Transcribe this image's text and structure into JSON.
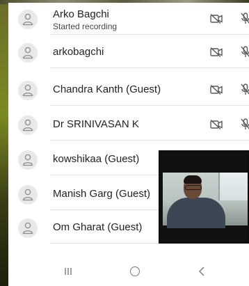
{
  "participants": [
    {
      "name": "Arko  Bagchi",
      "status": "Started recording",
      "cam_icon": "camera-off-icon",
      "mic_icon": "mic-off-icon"
    },
    {
      "name": "arkobagchi",
      "cam_icon": "camera-off-icon",
      "mic_icon": "mic-off-icon"
    },
    {
      "name": "Chandra Kanth (Guest)",
      "cam_icon": "camera-off-icon",
      "mic_icon": "mic-off-icon"
    },
    {
      "name": "Dr SRINIVASAN K",
      "cam_icon": "camera-off-icon",
      "mic_icon": "mic-off-icon"
    },
    {
      "name": "kowshikaa (Guest)"
    },
    {
      "name": "Manish Garg (Guest)"
    },
    {
      "name": "Om Gharat (Guest)"
    }
  ],
  "navbar": {
    "recents_icon": "recents-icon",
    "home_icon": "home-icon",
    "back_icon": "back-icon"
  },
  "colors": {
    "text": "#222222",
    "icon": "#555555",
    "avatar_bg": "#e9e9ea",
    "divider": "#e4e4e4"
  }
}
